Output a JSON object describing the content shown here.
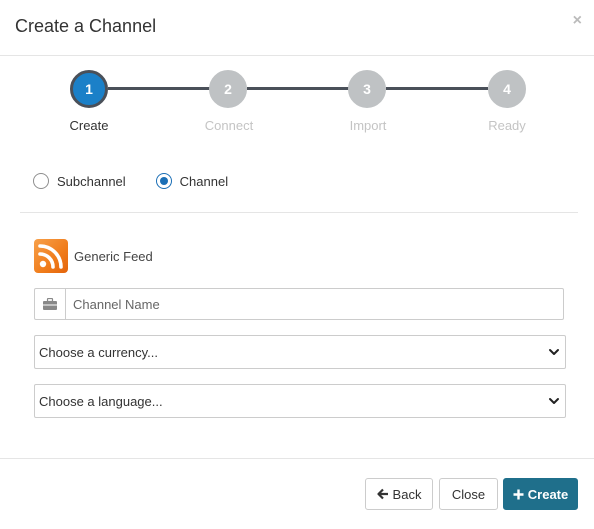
{
  "dialog": {
    "title": "Create a Channel",
    "close_symbol": "×"
  },
  "stepper": {
    "steps": [
      {
        "number": "1",
        "label": "Create",
        "active": true
      },
      {
        "number": "2",
        "label": "Connect",
        "active": false
      },
      {
        "number": "3",
        "label": "Import",
        "active": false
      },
      {
        "number": "4",
        "label": "Ready",
        "active": false
      }
    ]
  },
  "channel_type": {
    "options": [
      {
        "label": "Subchannel",
        "checked": false
      },
      {
        "label": "Channel",
        "checked": true
      }
    ]
  },
  "feed": {
    "label": "Generic Feed",
    "icon": "rss-icon"
  },
  "form": {
    "channel_name": {
      "value": "",
      "placeholder": "Channel Name",
      "icon": "briefcase-icon"
    },
    "currency": {
      "selected": "Choose a currency..."
    },
    "language": {
      "selected": "Choose a language..."
    }
  },
  "footer": {
    "back_label": "Back",
    "close_label": "Close",
    "create_label": "Create"
  },
  "colors": {
    "active_step": "#1b80c8",
    "inactive_step": "#bfc2c4",
    "primary_button": "#1f6f8b",
    "rss_orange": "#f07c1b"
  }
}
